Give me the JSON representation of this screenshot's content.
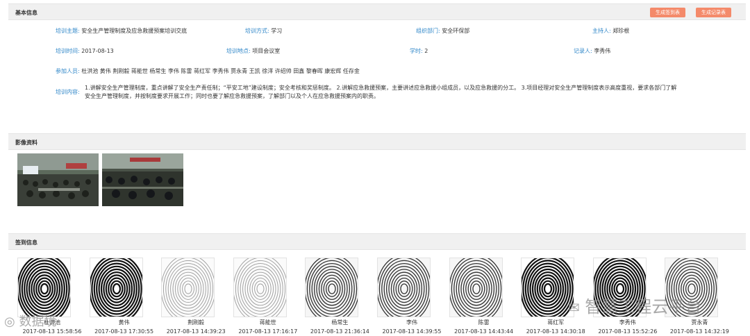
{
  "basic": {
    "title": "基本信息",
    "btn_sign": "生成签到表",
    "btn_record": "生成记录表",
    "fields": {
      "topic_label": "培训主题:",
      "topic": "安全生产管理制度及应急救援预案培训交底",
      "method_label": "培训方式:",
      "method": "学习",
      "dept_label": "组织部门:",
      "dept": "安全环保部",
      "host_label": "主持人:",
      "host": "郑珍根",
      "time_label": "培训时间:",
      "time": "2017-08-13",
      "place_label": "培训地点:",
      "place": "项目会议室",
      "hours_label": "学时:",
      "hours": "2",
      "recorder_label": "记录人:",
      "recorder": "李秀伟",
      "attendees_label": "参加人员:",
      "attendees": "杜洪池 黄伟 荆刚毅 蒋能世 杨常生 李伟 陈雷 蒋红军 李秀伟 贾永青 王凯 徐洋 许绍帅 田鑫 黎春晖 康宏辉 任存金",
      "content_label": "培训内容:",
      "content": "1.讲解安全生产管理制度，重点讲解了安全生产责任制；“平安工地”建设制度；安全考核和奖惩制度。 2.讲解应急救援预案，主要讲述应急救援小组成员，以及应急救援的分工。 3.项目经理对安全生产管理制度表示高度重视，要求各部门了解安全生产管理制度，并按制度要求开展工作；同时也要了解应急救援预案，了解部门以及个人在应急救援预案内的职责。"
    }
  },
  "media": {
    "title": "影像资料"
  },
  "signin": {
    "title": "签到信息",
    "records": [
      {
        "name": "杜洪池",
        "time": "2017-08-13 15:58:56",
        "tone": "dark"
      },
      {
        "name": "黄伟",
        "time": "2017-08-13 17:30:55",
        "tone": "dark"
      },
      {
        "name": "荆刚毅",
        "time": "2017-08-13 14:39:23",
        "tone": "light"
      },
      {
        "name": "蒋能世",
        "time": "2017-08-13 17:16:17",
        "tone": "light"
      },
      {
        "name": "杨常生",
        "time": "2017-08-13 21:36:14",
        "tone": "medium"
      },
      {
        "name": "李伟",
        "time": "2017-08-13 14:39:55",
        "tone": "medium"
      },
      {
        "name": "陈雷",
        "time": "2017-08-13 14:43:44",
        "tone": "medium"
      },
      {
        "name": "蒋红军",
        "time": "2017-08-13 14:30:18",
        "tone": "dark"
      },
      {
        "name": "李秀伟",
        "time": "2017-08-13 15:52:26",
        "tone": "dark"
      },
      {
        "name": "贾永青",
        "time": "2017-08-13 14:32:19",
        "tone": "medium"
      }
    ]
  },
  "watermarks": {
    "wechat": "智慧工程云平台",
    "left": "数据境"
  },
  "colors": {
    "label": "#2e86c8",
    "button": "#f48a6a",
    "header_bg": "#f0f0f0"
  }
}
